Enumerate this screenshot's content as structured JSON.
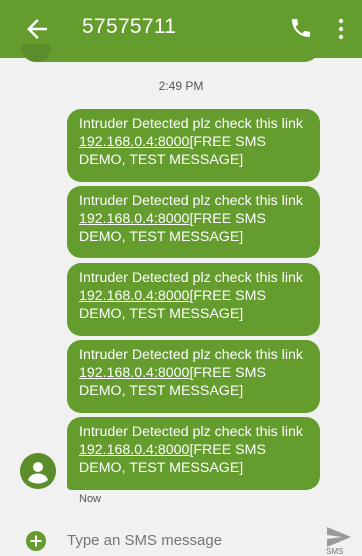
{
  "header": {
    "title": "57575711",
    "back_icon": "arrow-left-icon",
    "call_icon": "phone-icon",
    "menu_icon": "more-vert-icon",
    "color": "#649c2e"
  },
  "conversation": {
    "timestamp": "2:49 PM",
    "messages": [
      {
        "pre": "Intruder Detected plz check this link ",
        "link": "192.168.0.4:8000",
        "post": "[FREE SMS DEMO, TEST MESSAGE]"
      },
      {
        "pre": "Intruder Detected plz check this link ",
        "link": "192.168.0.4:8000",
        "post": "[FREE SMS DEMO, TEST MESSAGE]"
      },
      {
        "pre": "Intruder Detected plz check this link ",
        "link": "192.168.0.4:8000",
        "post": "[FREE SMS DEMO, TEST MESSAGE]"
      },
      {
        "pre": "Intruder Detected plz check this link ",
        "link": "192.168.0.4:8000",
        "post": "[FREE SMS DEMO, TEST MESSAGE]"
      },
      {
        "pre": "Intruder Detected plz check this link ",
        "link": "192.168.0.4:8000",
        "post": "[FREE SMS DEMO, TEST MESSAGE]"
      }
    ],
    "last_status": "Now"
  },
  "composer": {
    "placeholder": "Type an SMS message",
    "send_label": "SMS",
    "add_icon": "add-circle-icon",
    "send_icon": "send-icon"
  }
}
